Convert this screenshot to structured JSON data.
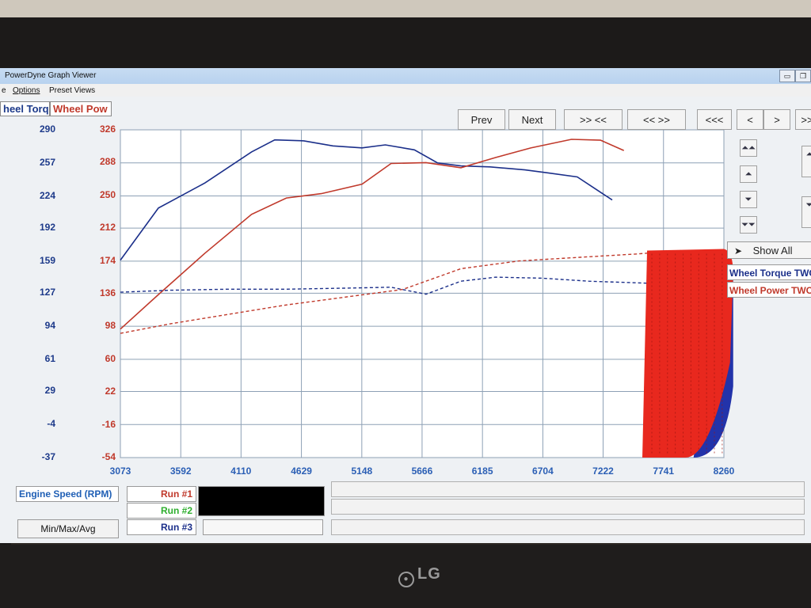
{
  "window": {
    "title": "PowerDyne Graph Viewer"
  },
  "menu": {
    "file_partial": "e",
    "options": "Options",
    "preset_views": "Preset Views"
  },
  "axis_tabs": {
    "left": "heel Torq",
    "right": "Wheel Pow"
  },
  "toolbar": {
    "prev": "Prev",
    "next": "Next",
    "zoom_in": ">> <<",
    "zoom_out": "<< >>",
    "far_left": "<<<",
    "left": "<",
    "right": ">",
    "far_right": ">>"
  },
  "side": {
    "show_all": "Show All",
    "legend": [
      {
        "label": "Wheel Torque TWC",
        "color": "#1b2f8a"
      },
      {
        "label": "Wheel Power TWC",
        "color": "#c0392b"
      }
    ]
  },
  "footer": {
    "engine_speed": "Engine Speed (RPM)",
    "min_max_avg": "Min/Max/Avg",
    "runs": [
      {
        "label": "Run #1",
        "color": "#c0392b"
      },
      {
        "label": "Run #2",
        "color": "#2eae2e"
      },
      {
        "label": "Run #3",
        "color": "#1b2f8a"
      }
    ]
  },
  "chart_data": {
    "type": "line",
    "xlabel": "Engine Speed (RPM)",
    "x_ticks": [
      3073,
      3592,
      4110,
      4629,
      5148,
      5666,
      6185,
      6704,
      7222,
      7741,
      8260
    ],
    "y_left_ticks": [
      290,
      257,
      224,
      192,
      159,
      127,
      94,
      61,
      29,
      -4,
      -37
    ],
    "y_right_ticks": [
      326,
      288,
      250,
      212,
      174,
      136,
      98,
      60,
      22,
      -16,
      -54
    ],
    "xlim": [
      3073,
      8260
    ],
    "ylim_left": [
      -37,
      290
    ],
    "ylim_right": [
      -54,
      326
    ],
    "colors": {
      "torque": "#1b2f8a",
      "power": "#c0392b"
    },
    "series": [
      {
        "name": "Wheel Torque TWC",
        "axis": "left",
        "style": "solid",
        "x": [
          3073,
          3400,
          3800,
          4200,
          4400,
          4650,
          4900,
          5150,
          5350,
          5600,
          5800,
          6000,
          6250,
          6550,
          6750,
          7000,
          7300
        ],
        "y": [
          160,
          212,
          237,
          268,
          280,
          279,
          274,
          272,
          275,
          270,
          257,
          254,
          253,
          250,
          247,
          243,
          220
        ]
      },
      {
        "name": "Wheel Power TWC",
        "axis": "right",
        "style": "solid",
        "x": [
          3073,
          3400,
          3800,
          4200,
          4500,
          4800,
          5150,
          5400,
          5700,
          6000,
          6300,
          6600,
          6950,
          7200,
          7400
        ],
        "y": [
          95,
          135,
          183,
          228,
          247,
          252,
          263,
          287,
          288,
          282,
          294,
          305,
          315,
          314,
          302
        ]
      },
      {
        "name": "Wheel Torque TWC",
        "axis": "left",
        "style": "dashed",
        "x": [
          3073,
          3500,
          4000,
          4500,
          5000,
          5400,
          5700,
          6000,
          6300,
          6700,
          7100,
          7600
        ],
        "y": [
          128,
          130,
          131,
          131,
          132,
          133,
          126,
          139,
          143,
          142,
          139,
          137
        ]
      },
      {
        "name": "Wheel Power TWC",
        "axis": "right",
        "style": "dashed",
        "x": [
          3073,
          3500,
          4000,
          4500,
          5000,
          5500,
          6000,
          6500,
          7000,
          7500,
          7900
        ],
        "y": [
          90,
          101,
          112,
          123,
          132,
          141,
          165,
          174,
          178,
          182,
          186
        ]
      }
    ]
  }
}
